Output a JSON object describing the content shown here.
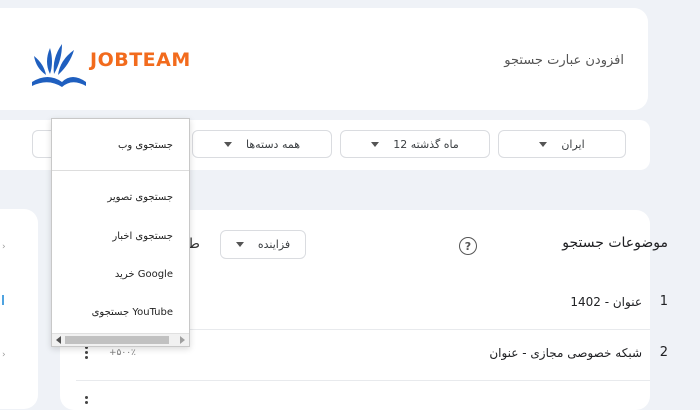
{
  "header": {
    "logo_text": "JOBTEAM",
    "add_search_term": "افزودن عبارت جستجو"
  },
  "filters": {
    "country": "ایران",
    "period": "12 ماه گذشته",
    "category": "همه دسته‌ها"
  },
  "search_type_menu": {
    "items": [
      "جستجوی وب",
      "جستجوی تصویر",
      "جستجوی اخبار",
      "خرید Google",
      "جستجوی YouTube"
    ]
  },
  "topics": {
    "title": "موضوعات جستجو",
    "help_icon": "?",
    "sort_label": "فزاینده",
    "rows": [
      {
        "num": "1",
        "text": "1402 - عنوان"
      },
      {
        "num": "2",
        "text": "شبکه خصوصی مجازی - عنوان",
        "trend": "+۵۰۰٪"
      }
    ]
  },
  "colors": {
    "logo_orange": "#f26b1d",
    "logo_blue": "#1f5fbf",
    "background": "#eff2f7"
  }
}
